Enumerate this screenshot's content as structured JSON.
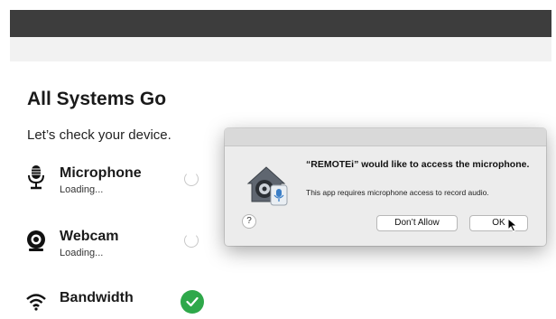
{
  "app": {
    "title": "All Systems Go",
    "subtitle": "Let’s check your device."
  },
  "checks": [
    {
      "name": "Microphone",
      "status": "Loading...",
      "icon": "microphone-icon",
      "state": "loading"
    },
    {
      "name": "Webcam",
      "status": "Loading...",
      "icon": "webcam-icon",
      "state": "loading"
    },
    {
      "name": "Bandwidth",
      "status": "",
      "icon": "wifi-icon",
      "state": "done"
    }
  ],
  "dialog": {
    "heading": "“REMOTEi” would like to access the microphone.",
    "message": "This app requires microphone access to record audio.",
    "help_label": "?",
    "deny_label": "Don’t Allow",
    "ok_label": "OK"
  },
  "colors": {
    "topbar": "#3d3d3d",
    "success": "#2ea84a",
    "dialog_bg": "#ececec"
  }
}
